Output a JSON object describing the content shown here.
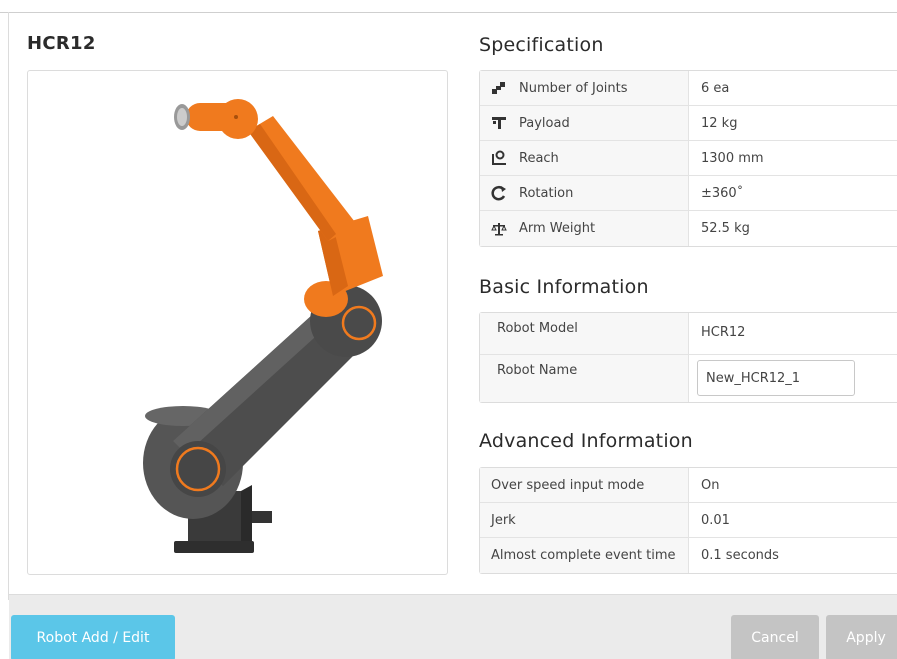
{
  "robot": {
    "title": "HCR12"
  },
  "specification": {
    "title": "Specification",
    "rows": [
      {
        "icon": "joints-icon",
        "label": "Number of Joints",
        "value": "6 ea"
      },
      {
        "icon": "payload-icon",
        "label": "Payload",
        "value": "12 kg"
      },
      {
        "icon": "reach-icon",
        "label": "Reach",
        "value": "1300 mm"
      },
      {
        "icon": "rotation-icon",
        "label": "Rotation",
        "value": "±360˚"
      },
      {
        "icon": "scale-icon",
        "label": "Arm Weight",
        "value": "52.5 kg"
      }
    ]
  },
  "basic": {
    "title": "Basic Information",
    "model_label": "Robot Model",
    "model_value": "HCR12",
    "name_label": "Robot Name",
    "name_value": "New_HCR12_1"
  },
  "advanced": {
    "title": "Advanced Information",
    "rows": [
      {
        "label": "Over speed input mode",
        "value": "On"
      },
      {
        "label": "Jerk",
        "value": "0.01"
      },
      {
        "label": "Almost complete event time",
        "value": "0.1 seconds"
      }
    ]
  },
  "footer": {
    "add_edit_label": "Robot Add / Edit",
    "cancel_label": "Cancel",
    "apply_label": "Apply"
  },
  "colors": {
    "accent": "#5bc6e8",
    "robot_orange": "#f07a1e",
    "robot_gray": "#4a4a4a",
    "button_disabled": "#c4c4c4"
  }
}
